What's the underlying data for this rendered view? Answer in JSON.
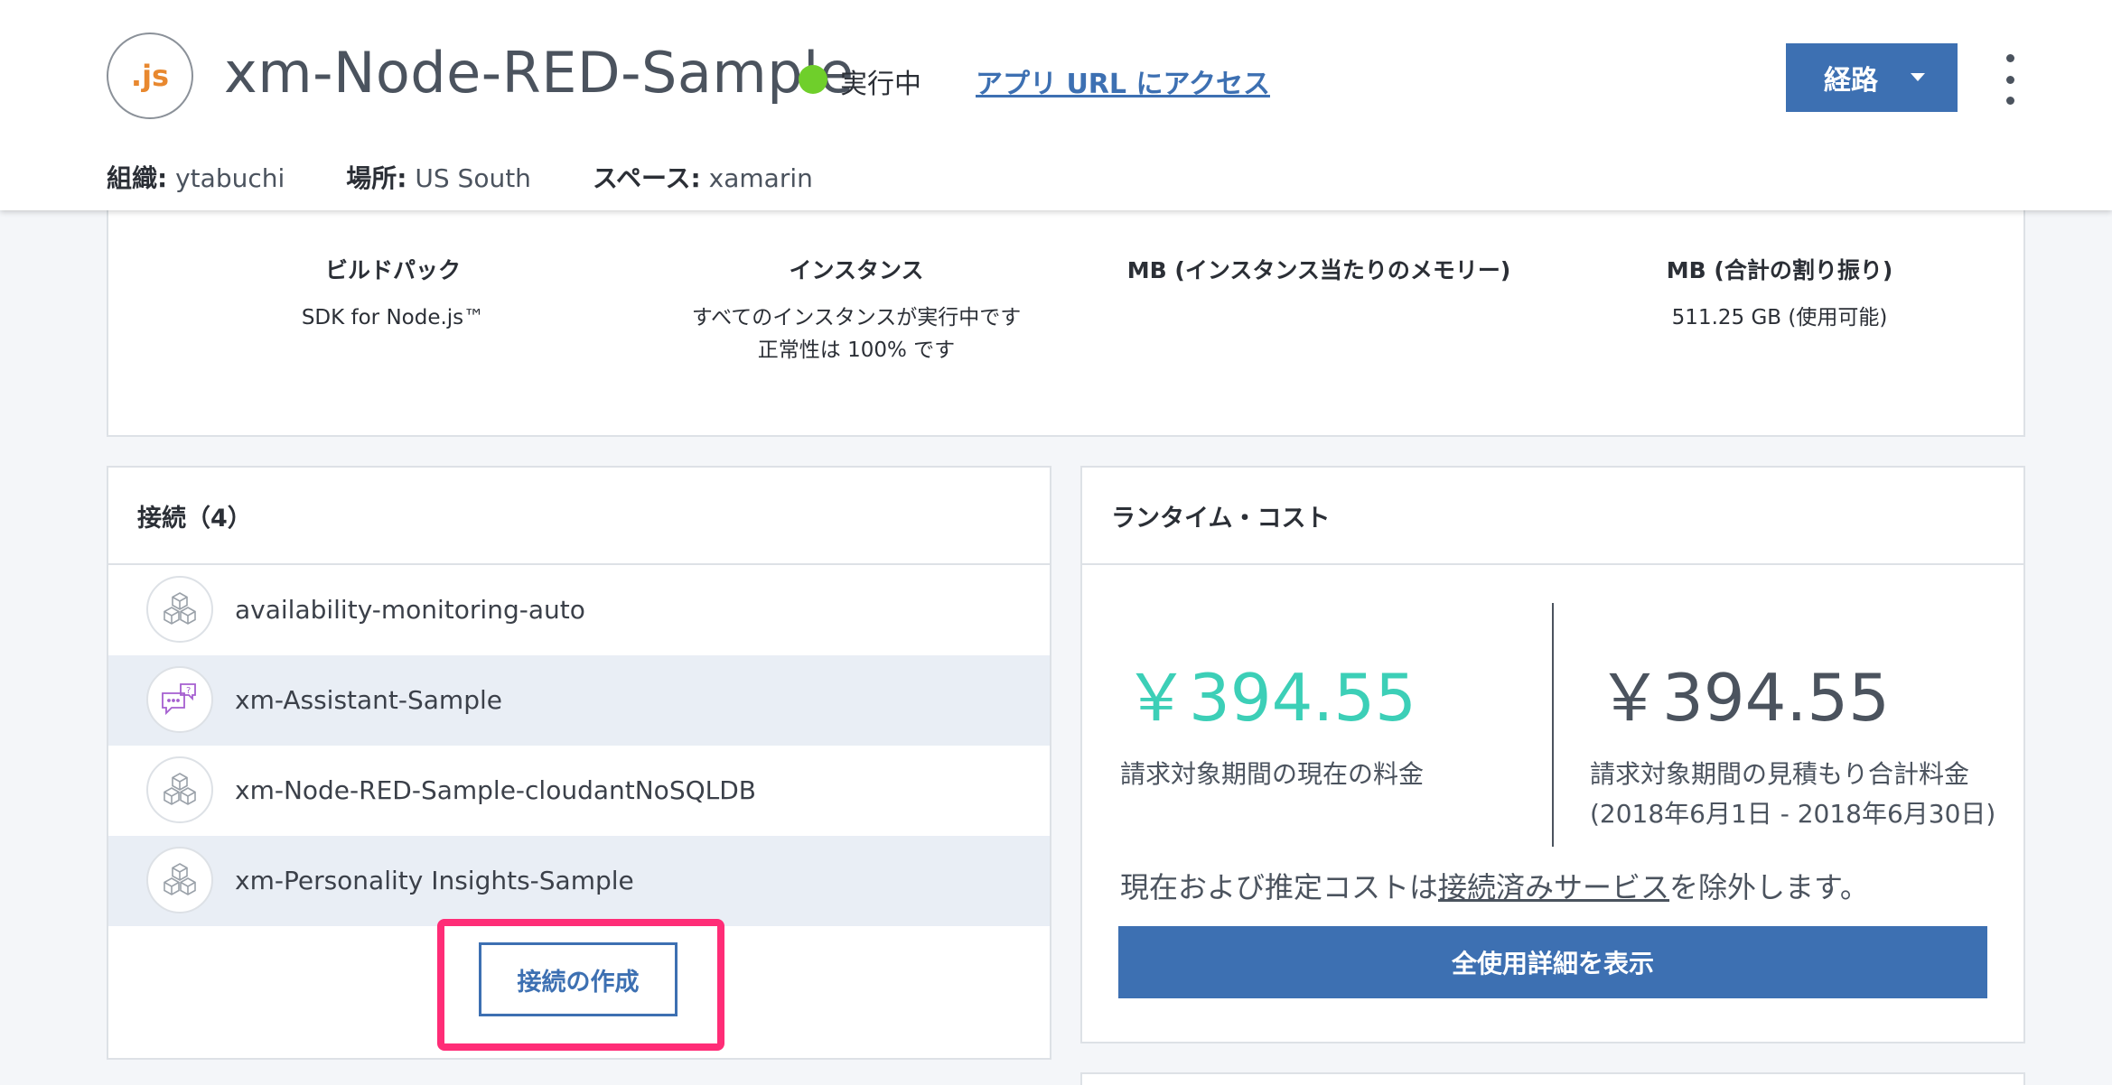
{
  "header": {
    "app_icon_text": ".js",
    "app_title": "xm-Node-RED-Sample",
    "status_text": "実行中",
    "status_color": "#6fcf2b",
    "app_url_link": "アプリ URL にアクセス",
    "route_button": "経路",
    "more_icon": "kebab-menu-icon",
    "meta": {
      "org_label": "組織:",
      "org_value": "ytabuchi",
      "location_label": "場所:",
      "location_value": "US South",
      "space_label": "スペース:",
      "space_value": "xamarin"
    }
  },
  "summary": {
    "columns": [
      {
        "title": "ビルドパック",
        "value": "SDK for Node.js™",
        "value2": ""
      },
      {
        "title": "インスタンス",
        "value": "すべてのインスタンスが実行中です",
        "value2": "正常性は 100% です"
      },
      {
        "title": "MB (インスタンス当たりのメモリー)",
        "value": "",
        "value2": ""
      },
      {
        "title": "MB (合計の割り振り)",
        "value": "511.25 GB (使用可能)",
        "value2": ""
      }
    ]
  },
  "connections": {
    "title": "接続（4）",
    "items": [
      {
        "name": "availability-monitoring-auto",
        "icon": "cube-stack-icon"
      },
      {
        "name": "xm-Assistant-Sample",
        "icon": "chat-bubbles-icon"
      },
      {
        "name": "xm-Node-RED-Sample-cloudantNoSQLDB",
        "icon": "cube-stack-icon"
      },
      {
        "name": "xm-Personality Insights-Sample",
        "icon": "cube-stack-icon"
      }
    ],
    "create_button": "接続の作成"
  },
  "cost": {
    "title": "ランタイム・コスト",
    "current_amount": "￥394.55",
    "current_label": "請求対象期間の現在の料金",
    "estimate_amount": "￥394.55",
    "estimate_label": "請求対象期間の見積もり合計料金",
    "estimate_period": "(2018年6月1日 - 2018年6月30日)",
    "note_prefix": "現在および推定コストは",
    "note_link": "接続済みサービス",
    "note_suffix": "を除外します。",
    "usage_button": "全使用詳細を表示",
    "current_color": "#3ccfb7",
    "accent_color": "#3d70b2"
  }
}
